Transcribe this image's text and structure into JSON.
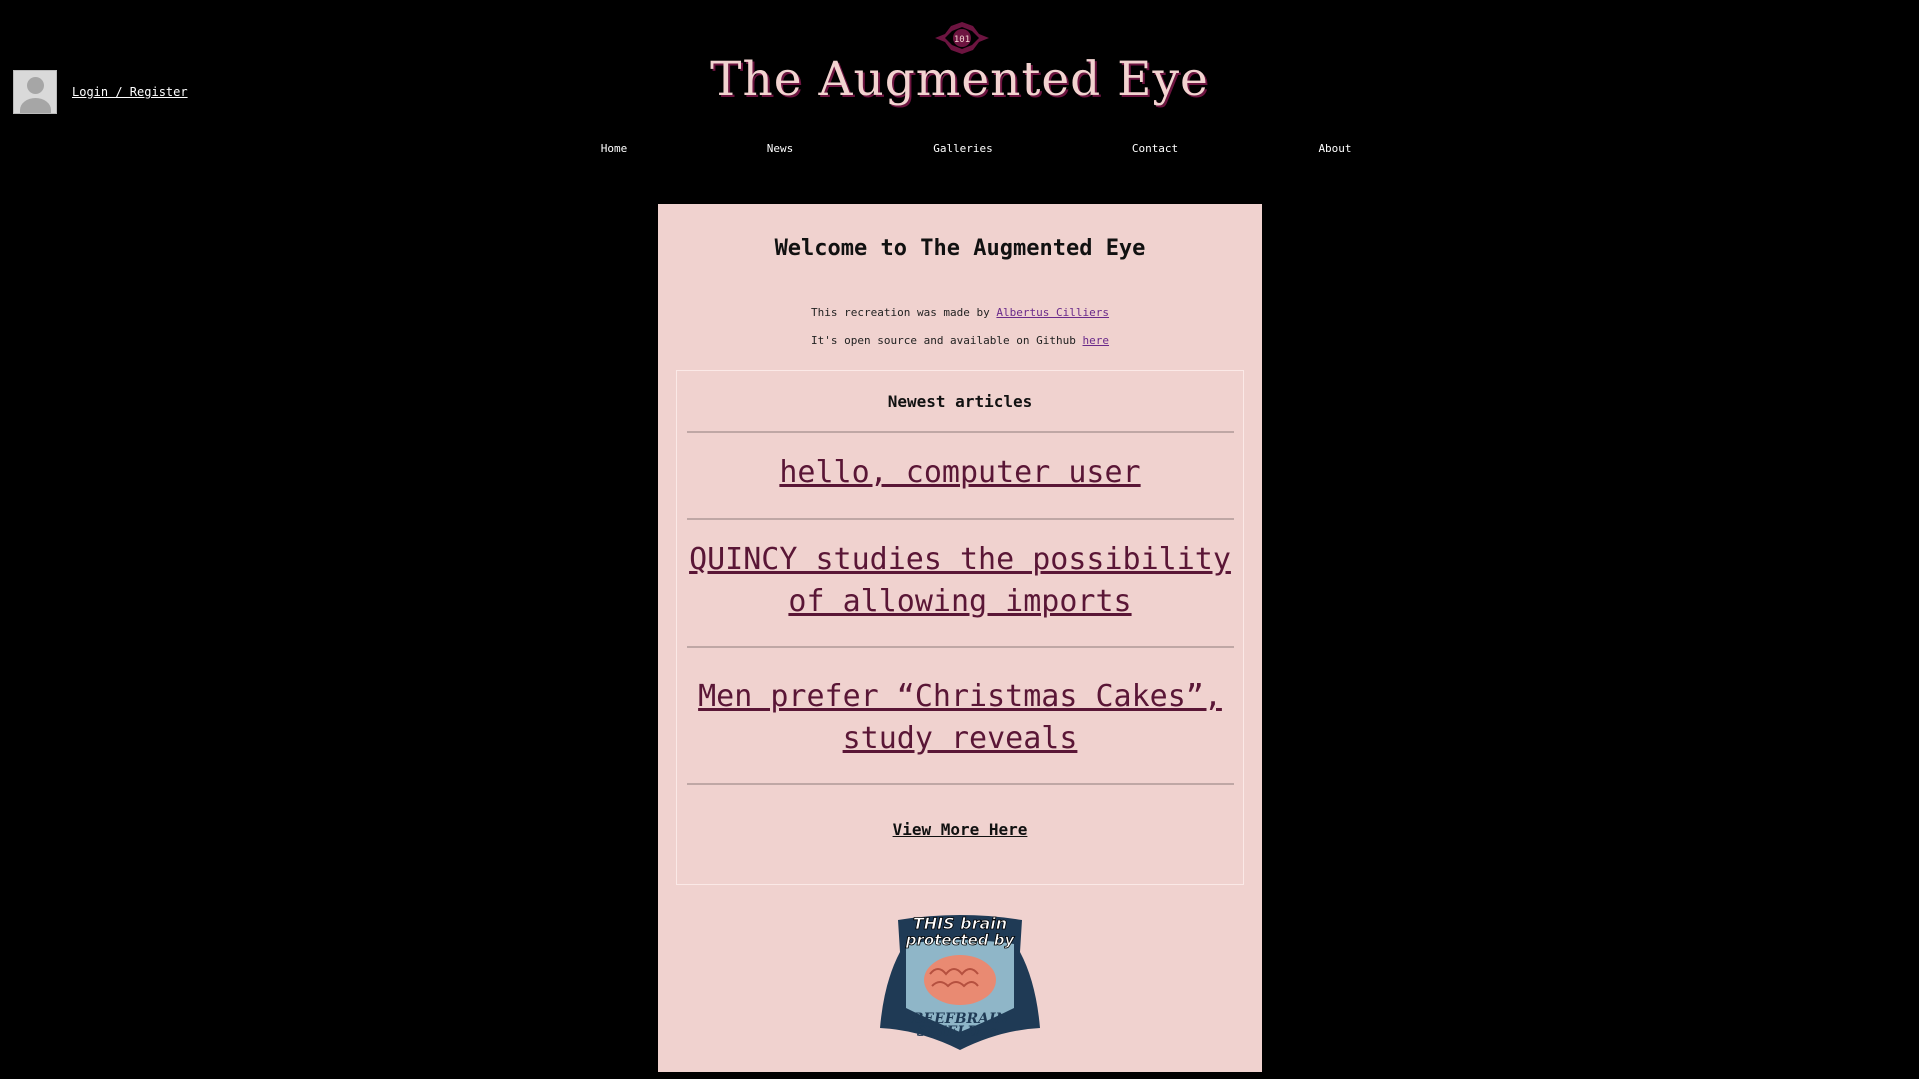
{
  "auth": {
    "link_label": "Login / Register"
  },
  "header": {
    "logo_icon": "eye-emblem-icon",
    "title": "The Augmented Eye"
  },
  "nav": {
    "items": [
      {
        "label": "Home"
      },
      {
        "label": "News"
      },
      {
        "label": "Galleries"
      },
      {
        "label": "Contact"
      },
      {
        "label": "About"
      }
    ]
  },
  "main": {
    "welcome": "Welcome to The Augmented Eye",
    "credit_prefix": "This recreation was made by",
    "credit_author": "Albertus Cilliers",
    "source_prefix": "It's open source and available on Github",
    "source_link": "here",
    "articles_heading": "Newest articles",
    "articles": [
      {
        "title": "hello, computer user"
      },
      {
        "title": "QUINCY studies the possibility of allowing imports"
      },
      {
        "title": "Men prefer “Christmas Cakes”, study reveals"
      }
    ],
    "view_more": "View More Here"
  },
  "badge": {
    "line1": "THIS brain",
    "line2": "protected by",
    "line3": "BEEFBRAIN",
    "line4": "SHIELD",
    "line5": "PRO"
  },
  "colors": {
    "background": "#000000",
    "panel": "#f0d2cf",
    "title_text": "#f2d3d0",
    "title_shadow": "#6d1440",
    "article_link": "#5a1636",
    "credit_link": "#6a2a8a"
  }
}
